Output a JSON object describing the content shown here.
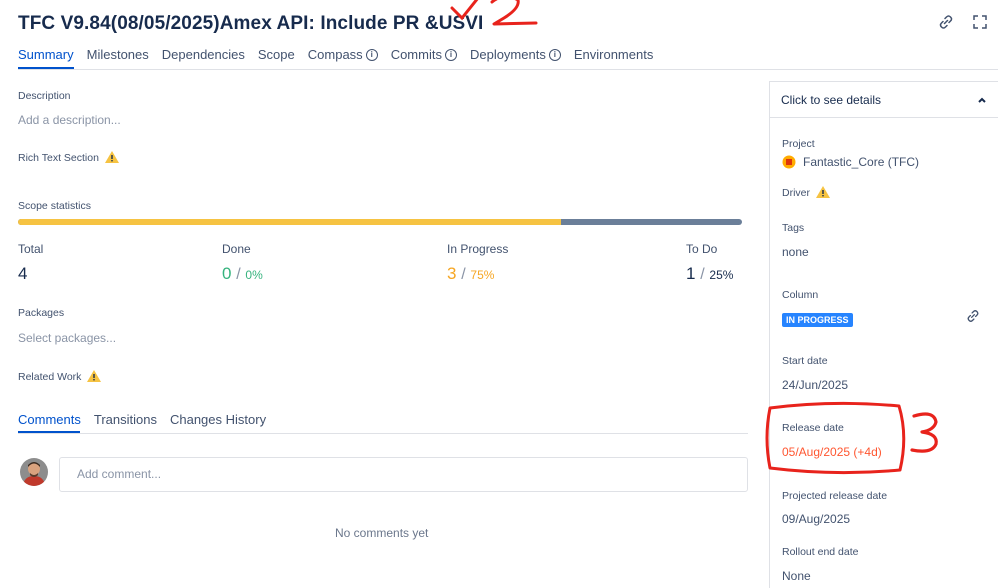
{
  "header": {
    "title": "TFC V9.84(08/05/2025)Amex API: Include PR &USVI",
    "annotation_2": "2",
    "annotation_3": "3"
  },
  "tabs": [
    {
      "label": "Summary",
      "active": true
    },
    {
      "label": "Milestones"
    },
    {
      "label": "Dependencies"
    },
    {
      "label": "Scope"
    },
    {
      "label": "Compass",
      "info": true
    },
    {
      "label": "Commits",
      "info": true
    },
    {
      "label": "Deployments",
      "info": true
    },
    {
      "label": "Environments"
    }
  ],
  "description": {
    "label": "Description",
    "placeholder": "Add a description..."
  },
  "rich_text": {
    "label": "Rich Text Section"
  },
  "scope": {
    "label": "Scope statistics",
    "progress_done_fraction": 0.75,
    "total_label": "Total",
    "total_value": "4",
    "done_label": "Done",
    "done_value": "0",
    "done_pct": "0%",
    "inprog_label": "In Progress",
    "inprog_value": "3",
    "inprog_pct": "75%",
    "todo_label": "To Do",
    "todo_value": "1",
    "todo_pct": "25%",
    "slash": "/"
  },
  "packages": {
    "label": "Packages",
    "placeholder": "Select packages..."
  },
  "related": {
    "label": "Related Work"
  },
  "comments": {
    "tabs": [
      "Comments",
      "Transitions",
      "Changes History"
    ],
    "input_placeholder": "Add comment...",
    "empty": "No comments yet"
  },
  "side": {
    "header": "Click to see details",
    "project_label": "Project",
    "project_value": "Fantastic_Core (TFC)",
    "driver_label": "Driver",
    "tags_label": "Tags",
    "tags_value": "none",
    "column_label": "Column",
    "column_value": "IN PROGRESS",
    "start_label": "Start date",
    "start_value": "24/Jun/2025",
    "release_label": "Release date",
    "release_value": "05/Aug/2025 (+4d)",
    "projected_label": "Projected release date",
    "projected_value": "09/Aug/2025",
    "rollout_label": "Rollout end date",
    "rollout_value": "None"
  },
  "colors": {
    "accent": "#0052cc",
    "warning": "#f6c342",
    "progress_todo": "#6b7f99",
    "release": "#ff5630",
    "annotation": "#e8231c"
  },
  "icons": [
    "link-icon",
    "fullscreen-icon",
    "info-icon",
    "warning-icon",
    "chevron-up-icon",
    "project-icon",
    "avatar"
  ]
}
